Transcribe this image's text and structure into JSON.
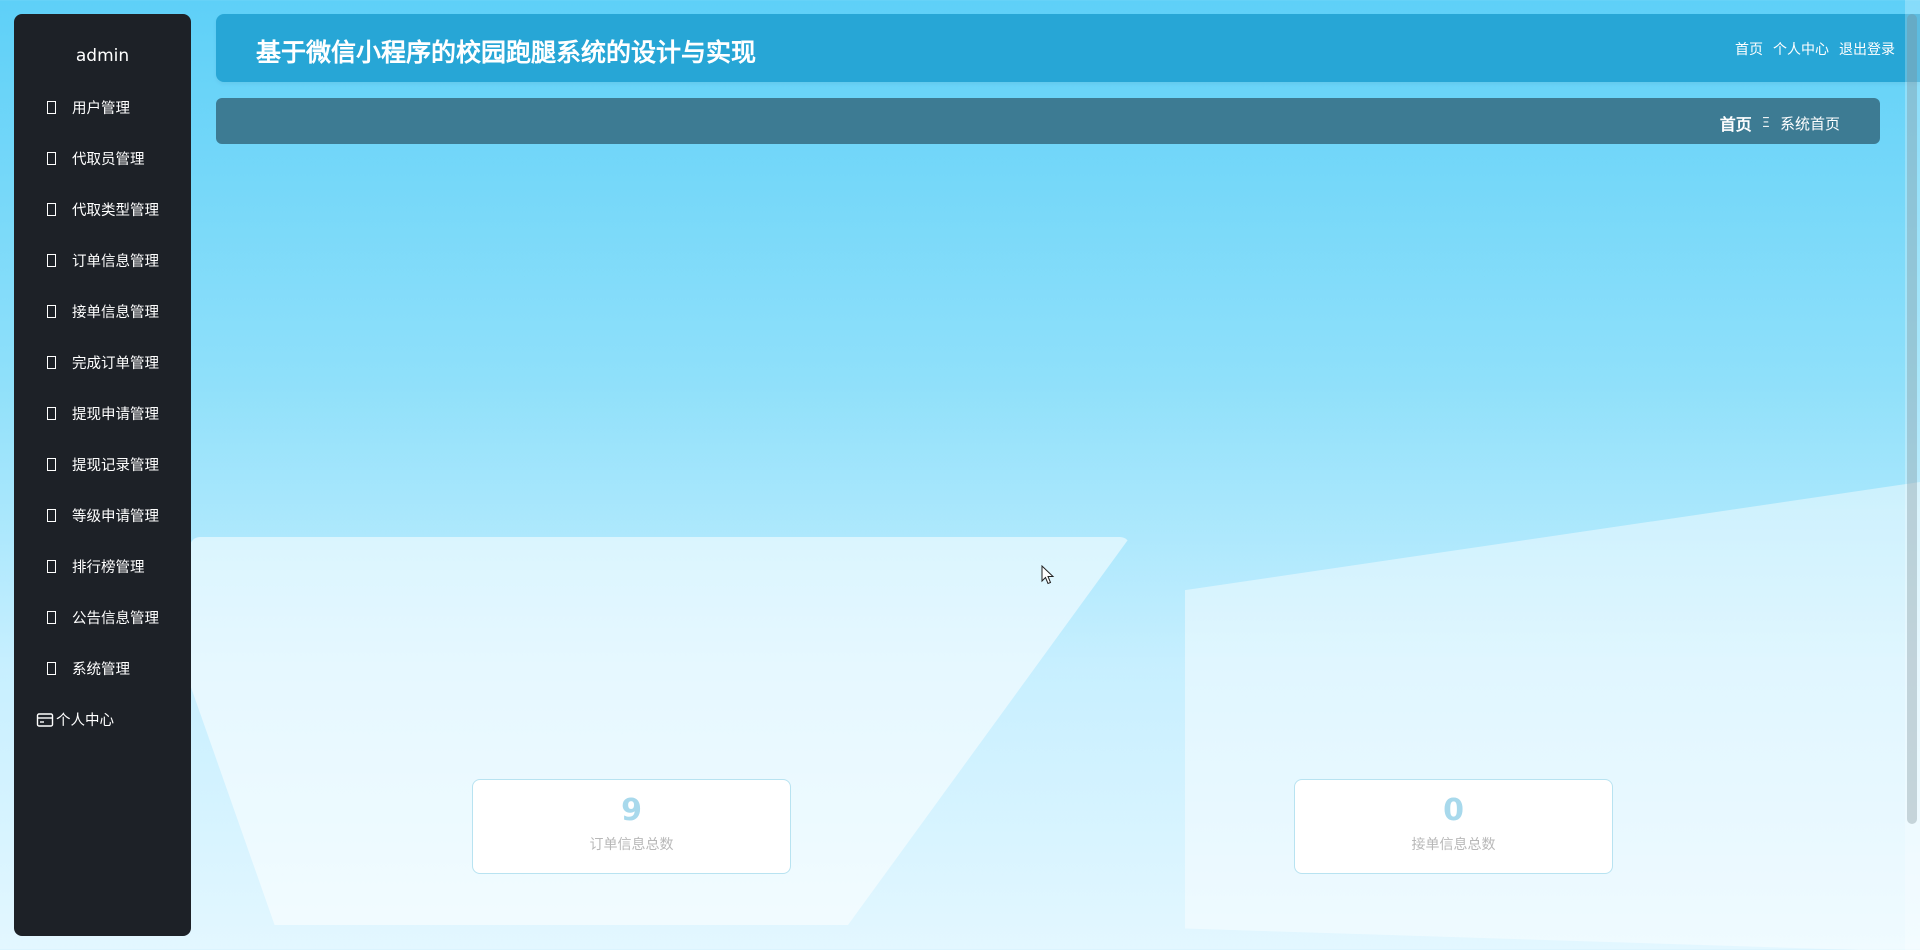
{
  "sidebar": {
    "username": "admin",
    "items": [
      {
        "label": "用户管理"
      },
      {
        "label": "代取员管理"
      },
      {
        "label": "代取类型管理"
      },
      {
        "label": "订单信息管理"
      },
      {
        "label": "接单信息管理"
      },
      {
        "label": "完成订单管理"
      },
      {
        "label": "提现申请管理"
      },
      {
        "label": "提现记录管理"
      },
      {
        "label": "等级申请管理"
      },
      {
        "label": "排行榜管理"
      },
      {
        "label": "公告信息管理"
      },
      {
        "label": "系统管理"
      }
    ],
    "personal_center": "个人中心"
  },
  "header": {
    "title": "基于微信小程序的校园跑腿系统的设计与实现",
    "links": {
      "home": "首页",
      "profile": "个人中心",
      "logout": "退出登录"
    }
  },
  "breadcrumb": {
    "home": "首页",
    "separator": "Ξ",
    "current": "系统首页"
  },
  "stats": {
    "orders": {
      "value": "9",
      "label": "订单信息总数"
    },
    "accepts": {
      "value": "0",
      "label": "接单信息总数"
    }
  },
  "colors": {
    "sidebar_bg": "#1d2127",
    "header_bg": "#27a6d6",
    "breadcrumb_bg": "#3d7b93",
    "stat_value": "#a8d9ec"
  }
}
